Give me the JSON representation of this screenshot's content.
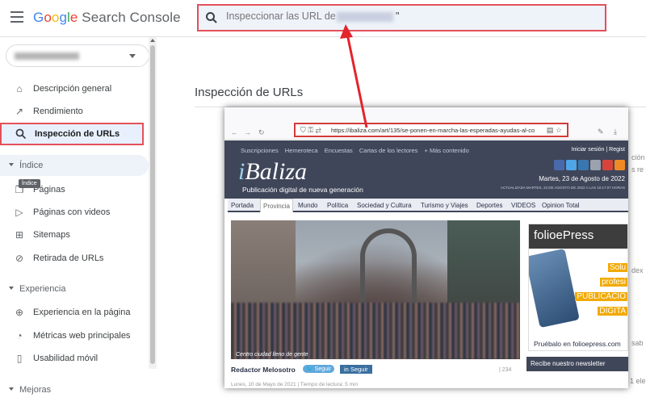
{
  "header": {
    "logo_google": "Google",
    "logo_product": "Search Console",
    "search_placeholder": "Inspeccionar las URL de",
    "search_suffix": "\""
  },
  "sidebar": {
    "items": [
      {
        "label": "Descripción general",
        "icon": "home-icon"
      },
      {
        "label": "Rendimiento",
        "icon": "trending-up-icon"
      },
      {
        "label": "Inspección de URLs",
        "icon": "search-icon",
        "active": true
      }
    ],
    "section_index": "Índice",
    "tooltip": "Índice",
    "index_items": [
      {
        "label": "Páginas",
        "icon": "pages-icon"
      },
      {
        "label": "Páginas con videos",
        "icon": "video-pages-icon"
      },
      {
        "label": "Sitemaps",
        "icon": "sitemap-icon"
      },
      {
        "label": "Retirada de URLs",
        "icon": "eye-off-icon"
      }
    ],
    "section_experience": "Experiencia",
    "experience_items": [
      {
        "label": "Experiencia en la página",
        "icon": "plus-circle-icon"
      },
      {
        "label": "Métricas web principales",
        "icon": "speed-icon"
      },
      {
        "label": "Usabilidad móvil",
        "icon": "phone-icon"
      }
    ],
    "section_improvements": "Mejoras"
  },
  "main": {
    "title": "Inspección de URLs",
    "right_fragments": [
      "ción",
      "s re",
      "dex",
      "sab",
      "1 ele"
    ]
  },
  "browser": {
    "url": "https://ibaliza.com/art/135/se-ponen-en-marcha-las-esperadas-ayudas-al-co",
    "site": {
      "topnav": [
        "Suscripciones",
        "Hemeroteca",
        "Encuestas",
        "Cartas de los lectores",
        "+ Más contenido"
      ],
      "login": "Iniciar sesión  |  Regist",
      "brand_i": "i",
      "brand_rest": "Baliza",
      "tagline": "Publicación digital de nueva generación",
      "date": "Martes, 23 de Agosto de 2022",
      "updated": "ACTUALIZADA MARTES, 23 DE AGOSTO DE 2022 A LAS 10:17:07 HORAS",
      "menu": [
        "Portada",
        "Provincia",
        "Mundo",
        "Política",
        "Sociedad y Cultura",
        "Turismo y Viajes",
        "Deportes",
        "VIDEOS",
        "Opinion Total"
      ],
      "photo_caption": "Centro ciudad lleno de gente",
      "author": "Redactor Melosotro",
      "follow_twitter": "Seguir",
      "follow_linkedin": "Seguir",
      "views": "| 234",
      "dateline": "Lunes, 10 de Mayo de 2021   |   Tiempo de lectura: 5 min",
      "ad_name": "folioePress",
      "ad_rows": [
        "Solu",
        "profesi",
        "PUBLICACIO",
        "DIGITA"
      ],
      "ad_foot": "Pruébalo en folioepress.com",
      "newsletter": "Recibe nuestro newsletter"
    }
  },
  "colors": {
    "accent_red": "#e3505a",
    "site_dark": "#3f4659",
    "active_bg": "#e8f0fe"
  }
}
